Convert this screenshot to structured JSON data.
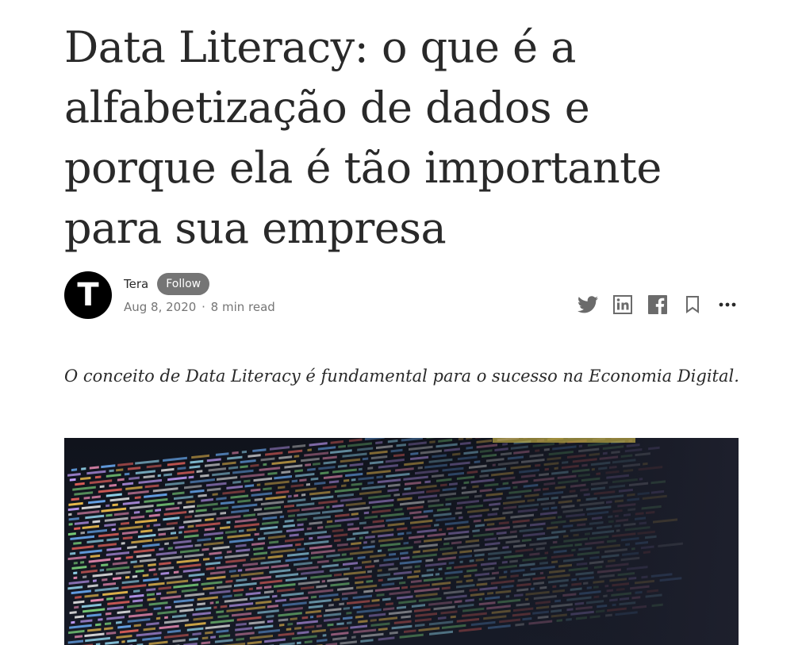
{
  "article": {
    "title": "Data Literacy: o que é a alfabetização de dados e porque ela é tão importante para sua empresa",
    "subtitle": "O conceito de Data Literacy é fundamental para o sucesso na Economia Digital."
  },
  "author": {
    "avatar_letter": "T",
    "name": "Tera",
    "follow_label": "Follow",
    "date": "Aug 8, 2020",
    "separator": "·",
    "read_time": "8 min read"
  },
  "actions": [
    {
      "icon": "twitter-icon"
    },
    {
      "icon": "linkedin-icon"
    },
    {
      "icon": "facebook-icon"
    },
    {
      "icon": "bookmark-icon"
    },
    {
      "icon": "more-icon"
    }
  ],
  "hero_image": {
    "subject": "code-on-screen"
  },
  "colors": {
    "text": "#292929",
    "muted": "#757575",
    "follow_bg": "#757575",
    "avatar_bg": "#000000"
  }
}
